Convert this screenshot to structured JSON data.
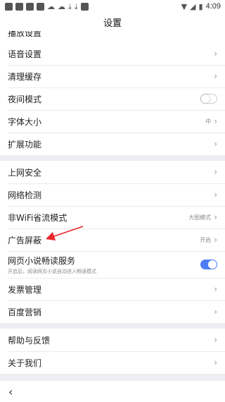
{
  "status": {
    "time": "4:09"
  },
  "header": {
    "title": "设置"
  },
  "partial_row": {
    "label": "播放设置"
  },
  "groups": [
    [
      {
        "label": "语音设置"
      },
      {
        "label": "清理缓存"
      },
      {
        "label": "夜间模式",
        "toggle": "off"
      },
      {
        "label": "字体大小",
        "value": "中"
      },
      {
        "label": "扩展功能"
      }
    ],
    [
      {
        "label": "上网安全"
      },
      {
        "label": "网络检测"
      },
      {
        "label": "非WiFi省流模式",
        "value": "大图模式"
      },
      {
        "label": "广告屏蔽",
        "value": "开启"
      },
      {
        "label": "网页小说畅读服务",
        "sub": "开启后，阅读网页小说自动进入畅读模式",
        "toggle": "on"
      },
      {
        "label": "发票管理"
      },
      {
        "label": "百度营销"
      }
    ],
    [
      {
        "label": "帮助与反馈"
      },
      {
        "label": "关于我们"
      }
    ]
  ],
  "colors": {
    "accent": "#4d7cf4",
    "annotation_arrow": "#e8262b"
  },
  "icons": {
    "chevron": "chevron-right-icon",
    "back": "back-arrow-icon"
  }
}
